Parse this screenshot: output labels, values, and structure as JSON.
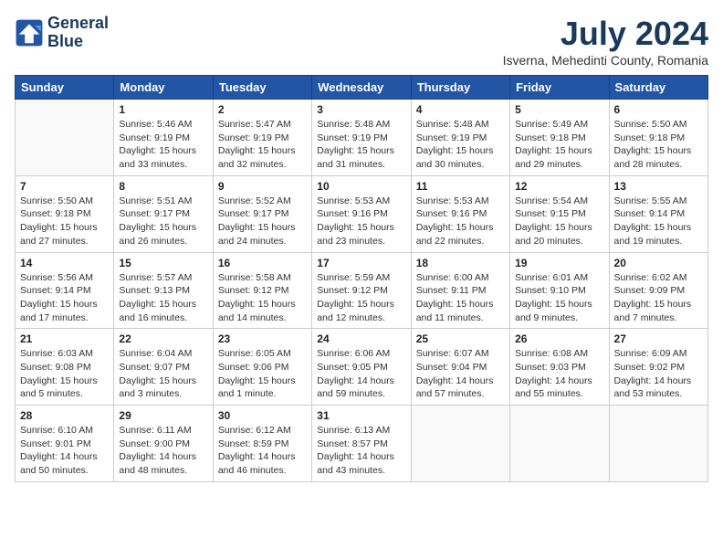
{
  "logo": {
    "line1": "General",
    "line2": "Blue"
  },
  "title": "July 2024",
  "subtitle": "Isverna, Mehedinti County, Romania",
  "days_of_week": [
    "Sunday",
    "Monday",
    "Tuesday",
    "Wednesday",
    "Thursday",
    "Friday",
    "Saturday"
  ],
  "weeks": [
    [
      {
        "day": "",
        "sunrise": "",
        "sunset": "",
        "daylight": ""
      },
      {
        "day": "1",
        "sunrise": "5:46 AM",
        "sunset": "9:19 PM",
        "daylight": "15 hours and 33 minutes."
      },
      {
        "day": "2",
        "sunrise": "5:47 AM",
        "sunset": "9:19 PM",
        "daylight": "15 hours and 32 minutes."
      },
      {
        "day": "3",
        "sunrise": "5:48 AM",
        "sunset": "9:19 PM",
        "daylight": "15 hours and 31 minutes."
      },
      {
        "day": "4",
        "sunrise": "5:48 AM",
        "sunset": "9:19 PM",
        "daylight": "15 hours and 30 minutes."
      },
      {
        "day": "5",
        "sunrise": "5:49 AM",
        "sunset": "9:18 PM",
        "daylight": "15 hours and 29 minutes."
      },
      {
        "day": "6",
        "sunrise": "5:50 AM",
        "sunset": "9:18 PM",
        "daylight": "15 hours and 28 minutes."
      }
    ],
    [
      {
        "day": "7",
        "sunrise": "5:50 AM",
        "sunset": "9:18 PM",
        "daylight": "15 hours and 27 minutes."
      },
      {
        "day": "8",
        "sunrise": "5:51 AM",
        "sunset": "9:17 PM",
        "daylight": "15 hours and 26 minutes."
      },
      {
        "day": "9",
        "sunrise": "5:52 AM",
        "sunset": "9:17 PM",
        "daylight": "15 hours and 24 minutes."
      },
      {
        "day": "10",
        "sunrise": "5:53 AM",
        "sunset": "9:16 PM",
        "daylight": "15 hours and 23 minutes."
      },
      {
        "day": "11",
        "sunrise": "5:53 AM",
        "sunset": "9:16 PM",
        "daylight": "15 hours and 22 minutes."
      },
      {
        "day": "12",
        "sunrise": "5:54 AM",
        "sunset": "9:15 PM",
        "daylight": "15 hours and 20 minutes."
      },
      {
        "day": "13",
        "sunrise": "5:55 AM",
        "sunset": "9:14 PM",
        "daylight": "15 hours and 19 minutes."
      }
    ],
    [
      {
        "day": "14",
        "sunrise": "5:56 AM",
        "sunset": "9:14 PM",
        "daylight": "15 hours and 17 minutes."
      },
      {
        "day": "15",
        "sunrise": "5:57 AM",
        "sunset": "9:13 PM",
        "daylight": "15 hours and 16 minutes."
      },
      {
        "day": "16",
        "sunrise": "5:58 AM",
        "sunset": "9:12 PM",
        "daylight": "15 hours and 14 minutes."
      },
      {
        "day": "17",
        "sunrise": "5:59 AM",
        "sunset": "9:12 PM",
        "daylight": "15 hours and 12 minutes."
      },
      {
        "day": "18",
        "sunrise": "6:00 AM",
        "sunset": "9:11 PM",
        "daylight": "15 hours and 11 minutes."
      },
      {
        "day": "19",
        "sunrise": "6:01 AM",
        "sunset": "9:10 PM",
        "daylight": "15 hours and 9 minutes."
      },
      {
        "day": "20",
        "sunrise": "6:02 AM",
        "sunset": "9:09 PM",
        "daylight": "15 hours and 7 minutes."
      }
    ],
    [
      {
        "day": "21",
        "sunrise": "6:03 AM",
        "sunset": "9:08 PM",
        "daylight": "15 hours and 5 minutes."
      },
      {
        "day": "22",
        "sunrise": "6:04 AM",
        "sunset": "9:07 PM",
        "daylight": "15 hours and 3 minutes."
      },
      {
        "day": "23",
        "sunrise": "6:05 AM",
        "sunset": "9:06 PM",
        "daylight": "15 hours and 1 minute."
      },
      {
        "day": "24",
        "sunrise": "6:06 AM",
        "sunset": "9:05 PM",
        "daylight": "14 hours and 59 minutes."
      },
      {
        "day": "25",
        "sunrise": "6:07 AM",
        "sunset": "9:04 PM",
        "daylight": "14 hours and 57 minutes."
      },
      {
        "day": "26",
        "sunrise": "6:08 AM",
        "sunset": "9:03 PM",
        "daylight": "14 hours and 55 minutes."
      },
      {
        "day": "27",
        "sunrise": "6:09 AM",
        "sunset": "9:02 PM",
        "daylight": "14 hours and 53 minutes."
      }
    ],
    [
      {
        "day": "28",
        "sunrise": "6:10 AM",
        "sunset": "9:01 PM",
        "daylight": "14 hours and 50 minutes."
      },
      {
        "day": "29",
        "sunrise": "6:11 AM",
        "sunset": "9:00 PM",
        "daylight": "14 hours and 48 minutes."
      },
      {
        "day": "30",
        "sunrise": "6:12 AM",
        "sunset": "8:59 PM",
        "daylight": "14 hours and 46 minutes."
      },
      {
        "day": "31",
        "sunrise": "6:13 AM",
        "sunset": "8:57 PM",
        "daylight": "14 hours and 43 minutes."
      },
      {
        "day": "",
        "sunrise": "",
        "sunset": "",
        "daylight": ""
      },
      {
        "day": "",
        "sunrise": "",
        "sunset": "",
        "daylight": ""
      },
      {
        "day": "",
        "sunrise": "",
        "sunset": "",
        "daylight": ""
      }
    ]
  ]
}
